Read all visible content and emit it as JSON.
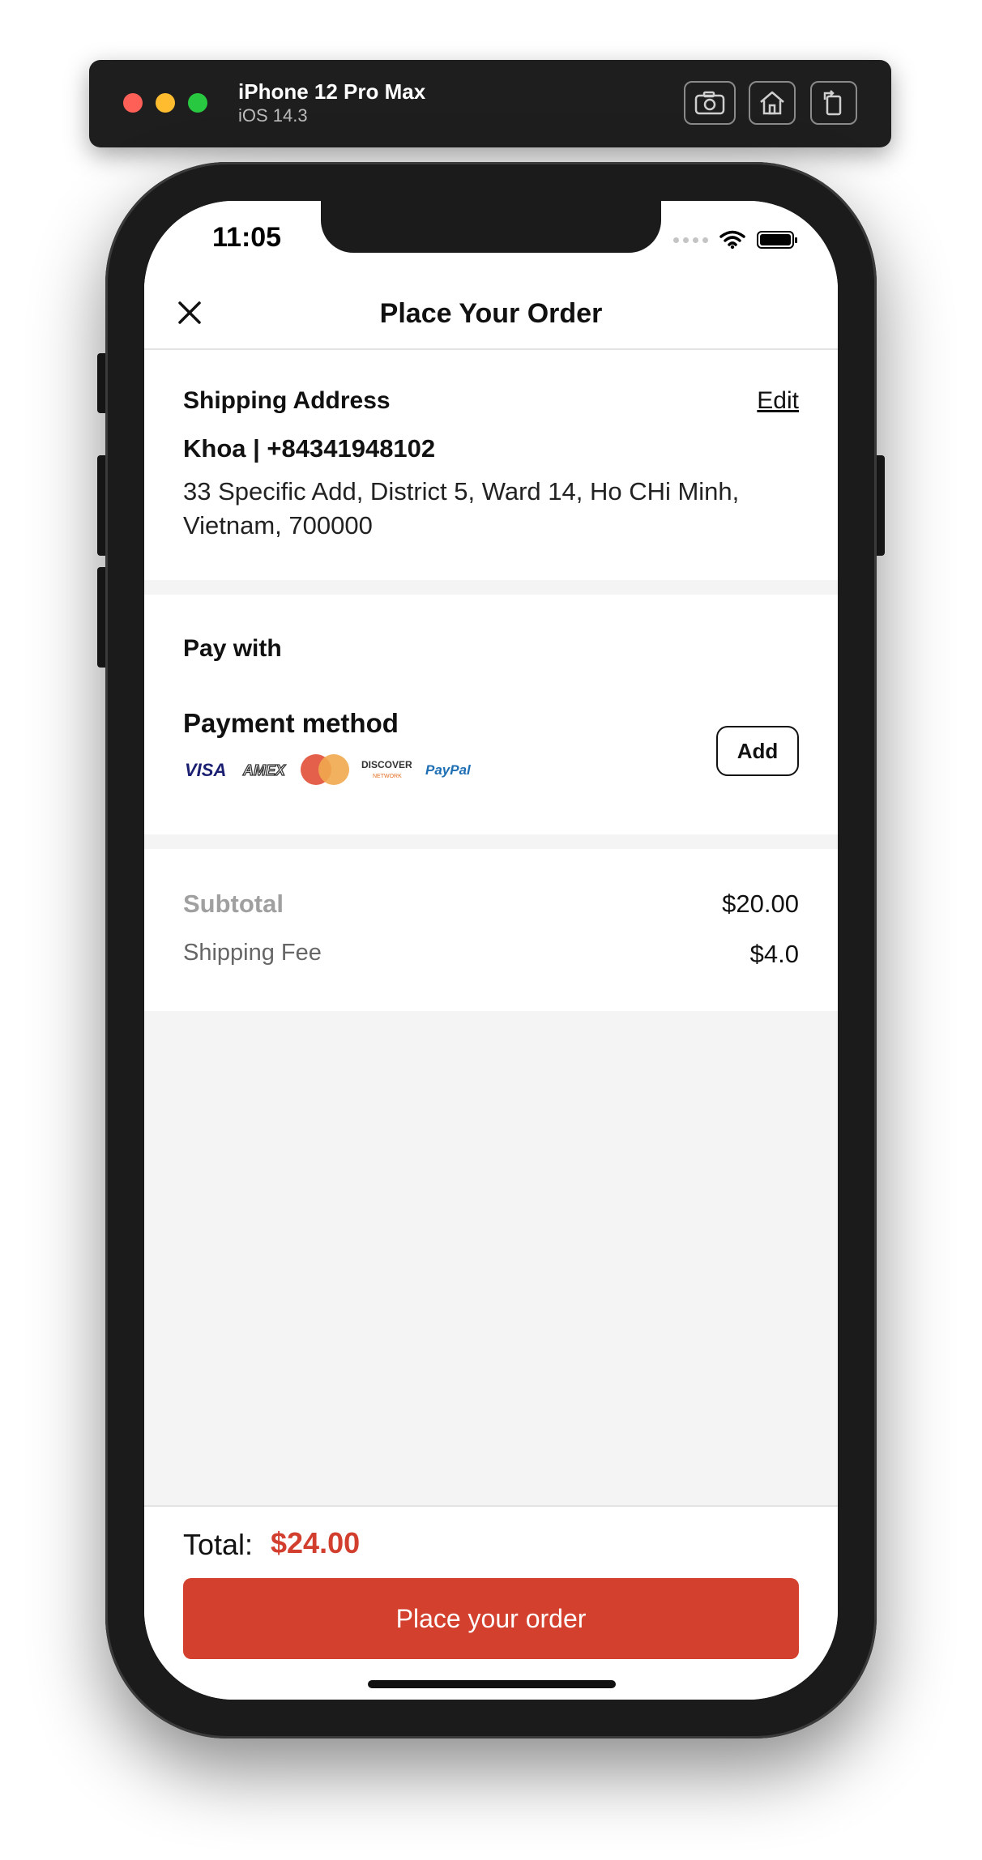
{
  "simulator": {
    "device_name": "iPhone 12 Pro Max",
    "os_version": "iOS 14.3",
    "buttons": [
      "screenshot-icon",
      "home-icon",
      "rotate-icon"
    ]
  },
  "status_bar": {
    "time": "11:05"
  },
  "nav": {
    "title": "Place Your Order",
    "close_icon": "close-icon"
  },
  "shipping": {
    "heading": "Shipping Address",
    "edit_label": "Edit",
    "name_phone": "Khoa | +84341948102",
    "address": "33 Specific Add, District 5, Ward 14, Ho CHi Minh, Vietnam, 700000"
  },
  "payment": {
    "heading": "Pay with",
    "method_label": "Payment method",
    "add_label": "Add",
    "card_logos": {
      "visa": "VISA",
      "amex": "AMEX",
      "discover": "DISCOVER",
      "discover_sub": "NETWORK",
      "paypal": "PayPal"
    }
  },
  "summary": {
    "subtotal_label": "Subtotal",
    "subtotal_value": "$20.00",
    "shipping_fee_label": "Shipping Fee",
    "shipping_fee_value": "$4.0"
  },
  "footer": {
    "total_label": "Total:",
    "total_value": "$24.00",
    "place_order_label": "Place your order"
  },
  "colors": {
    "accent": "#d3412e",
    "total_text": "#d23f2f",
    "screen_bg": "#f4f4f4"
  }
}
